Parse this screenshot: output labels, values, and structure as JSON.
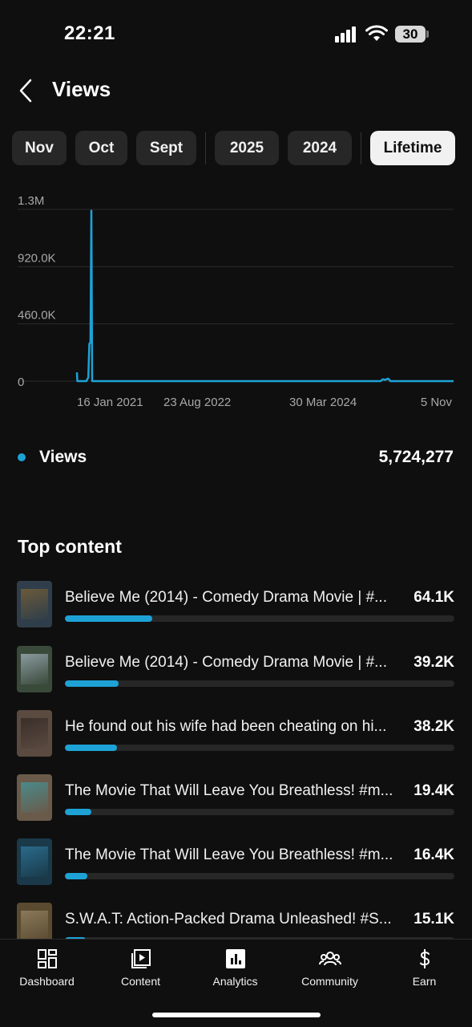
{
  "status_bar": {
    "time": "22:21",
    "battery": "30"
  },
  "header": {
    "title": "Views"
  },
  "filters": [
    {
      "label": "Nov",
      "active": false
    },
    {
      "label": "Oct",
      "active": false
    },
    {
      "label": "Sept",
      "active": false
    },
    {
      "label": "2025",
      "active": false
    },
    {
      "label": "2024",
      "active": false
    },
    {
      "label": "Lifetime",
      "active": true
    }
  ],
  "chart_data": {
    "type": "line",
    "x_ticks": [
      "16 Jan 2021",
      "23 Aug 2022",
      "30 Mar 2024",
      "5 Nov"
    ],
    "y_ticks": [
      "0",
      "460.0K",
      "920.0K",
      "1.3M"
    ],
    "ylim": [
      0,
      1380000
    ],
    "series": [
      {
        "name": "Views",
        "color": "#1ea2d6",
        "points": [
          [
            "2021-01-16",
            70000
          ],
          [
            "2021-01-18",
            0
          ],
          [
            "2021-03-01",
            0
          ],
          [
            "2021-03-10",
            30000
          ],
          [
            "2021-03-15",
            300000
          ],
          [
            "2021-03-20",
            310000
          ],
          [
            "2021-03-24",
            1370000
          ],
          [
            "2021-03-28",
            0
          ],
          [
            "2024-12-01",
            0
          ],
          [
            "2024-12-10",
            15000
          ],
          [
            "2024-12-20",
            10000
          ],
          [
            "2025-01-05",
            20000
          ],
          [
            "2025-01-15",
            0
          ],
          [
            "2025-11-05",
            0
          ]
        ]
      }
    ]
  },
  "legend": {
    "label": "Views",
    "total": "5,724,277",
    "color": "#1ea2d6"
  },
  "top_content": {
    "title": "Top content",
    "items": [
      {
        "title": "Believe Me (2014) - Comedy Drama Movie | #...",
        "value": "64.1K",
        "fraction": 0.224,
        "thumb": [
          "#6b5a3a",
          "#2f3e4a"
        ]
      },
      {
        "title": "Believe Me (2014) - Comedy Drama Movie | #...",
        "value": "39.2K",
        "fraction": 0.137,
        "thumb": [
          "#8a9aa0",
          "#3a4a3a"
        ]
      },
      {
        "title": "He found out his wife had been cheating on hi...",
        "value": "38.2K",
        "fraction": 0.133,
        "thumb": [
          "#3a2e2a",
          "#5a4a40"
        ]
      },
      {
        "title": "The Movie That Will Leave You Breathless! #m...",
        "value": "19.4K",
        "fraction": 0.068,
        "thumb": [
          "#4a8a8a",
          "#6a5a4a"
        ]
      },
      {
        "title": "The Movie That Will Leave You Breathless! #m...",
        "value": "16.4K",
        "fraction": 0.057,
        "thumb": [
          "#2a6a8a",
          "#1a3a4a"
        ]
      },
      {
        "title": "S.W.A.T: Action-Packed Drama Unleashed! #S...",
        "value": "15.1K",
        "fraction": 0.053,
        "thumb": [
          "#8a7a5a",
          "#5a4a30"
        ]
      }
    ]
  },
  "nav": [
    {
      "label": "Dashboard",
      "icon": "dashboard-icon"
    },
    {
      "label": "Content",
      "icon": "content-icon"
    },
    {
      "label": "Analytics",
      "icon": "analytics-icon"
    },
    {
      "label": "Community",
      "icon": "community-icon"
    },
    {
      "label": "Earn",
      "icon": "earn-icon"
    }
  ]
}
